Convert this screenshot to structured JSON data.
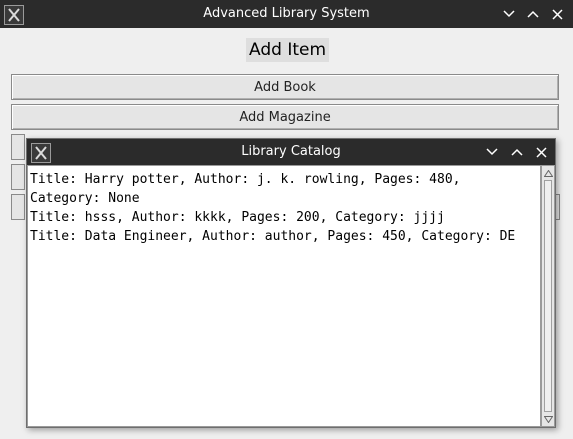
{
  "main_window": {
    "title": "Advanced Library System",
    "heading": "Add Item",
    "buttons": [
      "Add Book",
      "Add Magazine"
    ]
  },
  "catalog_window": {
    "title": "Library Catalog",
    "lines": [
      "Title: Harry potter, Author: j. k. rowling, Pages: 480,",
      "Category: None",
      "Title: hsss, Author: kkkk, Pages: 200, Category: jjjj",
      "Title: Data Engineer, Author: author, Pages: 450, Category: DE"
    ]
  },
  "icons": {
    "app": "app-icon",
    "minimize": "chevron-down-icon",
    "maximize": "chevron-up-icon",
    "close": "close-icon"
  }
}
